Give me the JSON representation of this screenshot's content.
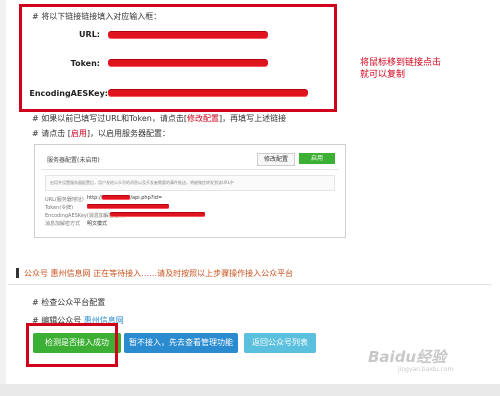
{
  "step1": {
    "heading": "# 将以下链接链接填入对应输入框：",
    "url_label": "URL:",
    "token_label": "Token:",
    "aes_label": "EncodingAESKey:"
  },
  "annotation": {
    "line1": "将鼠标移到链接点击",
    "line2": "就可以复制"
  },
  "step2": {
    "prefix": "# 如果以前已填写过URL和Token，请点击[",
    "link": "修改配置",
    "suffix": "]，再填写上述链接"
  },
  "step3": {
    "prefix": "# 请点击 [",
    "link": "启用",
    "suffix": "]，以启用服务器配置："
  },
  "screenshot": {
    "title": "服务器配置(未启用)",
    "edit_btn": "修改配置",
    "enable_btn": "启用",
    "notice": "启用并设置服务器配置后，用户发给公众号的消息以及开发者需要的事件推送，将被微信转发到该URL中",
    "url_label": "URL(服务器地址)",
    "url_value": "http://",
    "url_value_tail": "/api.php?id=",
    "token_label": "Token(令牌)",
    "aes_label": "EncodingAESKey(消息加解密密钥)",
    "mode_label": "消息加解密方式",
    "mode_value": "明文模式"
  },
  "status": {
    "prefix": "公众号",
    "name": "惠州信息网",
    "message": "正在等待接入……请及时按照以上步骤操作接入公众平台"
  },
  "check": {
    "heading": "# 检查公众平台配置",
    "edit_prefix": "# 编辑公众号",
    "edit_link": "惠州信息网"
  },
  "buttons": {
    "check": "检测是否接入成功",
    "skip": "暂不接入，先去查看管理功能",
    "back": "返回公众号列表"
  },
  "watermark": {
    "text": "Baidu经验",
    "sub": "jingyan.baidu.com"
  },
  "colors": {
    "red": "#d0021b",
    "green": "#3cb034",
    "blue": "#2a8bd0",
    "lightblue": "#5bc0de",
    "status_orange": "#c8531d"
  }
}
